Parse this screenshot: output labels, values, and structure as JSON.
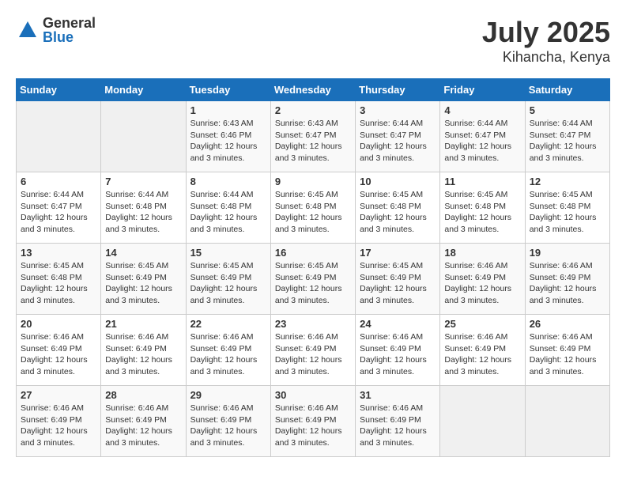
{
  "logo": {
    "general": "General",
    "blue": "Blue"
  },
  "title": {
    "month_year": "July 2025",
    "location": "Kihancha, Kenya"
  },
  "days_of_week": [
    "Sunday",
    "Monday",
    "Tuesday",
    "Wednesday",
    "Thursday",
    "Friday",
    "Saturday"
  ],
  "weeks": [
    [
      {
        "day": null
      },
      {
        "day": null
      },
      {
        "day": "1",
        "sunrise": "Sunrise: 6:43 AM",
        "sunset": "Sunset: 6:46 PM",
        "daylight": "Daylight: 12 hours and 3 minutes."
      },
      {
        "day": "2",
        "sunrise": "Sunrise: 6:43 AM",
        "sunset": "Sunset: 6:47 PM",
        "daylight": "Daylight: 12 hours and 3 minutes."
      },
      {
        "day": "3",
        "sunrise": "Sunrise: 6:44 AM",
        "sunset": "Sunset: 6:47 PM",
        "daylight": "Daylight: 12 hours and 3 minutes."
      },
      {
        "day": "4",
        "sunrise": "Sunrise: 6:44 AM",
        "sunset": "Sunset: 6:47 PM",
        "daylight": "Daylight: 12 hours and 3 minutes."
      },
      {
        "day": "5",
        "sunrise": "Sunrise: 6:44 AM",
        "sunset": "Sunset: 6:47 PM",
        "daylight": "Daylight: 12 hours and 3 minutes."
      }
    ],
    [
      {
        "day": "6",
        "sunrise": "Sunrise: 6:44 AM",
        "sunset": "Sunset: 6:47 PM",
        "daylight": "Daylight: 12 hours and 3 minutes."
      },
      {
        "day": "7",
        "sunrise": "Sunrise: 6:44 AM",
        "sunset": "Sunset: 6:48 PM",
        "daylight": "Daylight: 12 hours and 3 minutes."
      },
      {
        "day": "8",
        "sunrise": "Sunrise: 6:44 AM",
        "sunset": "Sunset: 6:48 PM",
        "daylight": "Daylight: 12 hours and 3 minutes."
      },
      {
        "day": "9",
        "sunrise": "Sunrise: 6:45 AM",
        "sunset": "Sunset: 6:48 PM",
        "daylight": "Daylight: 12 hours and 3 minutes."
      },
      {
        "day": "10",
        "sunrise": "Sunrise: 6:45 AM",
        "sunset": "Sunset: 6:48 PM",
        "daylight": "Daylight: 12 hours and 3 minutes."
      },
      {
        "day": "11",
        "sunrise": "Sunrise: 6:45 AM",
        "sunset": "Sunset: 6:48 PM",
        "daylight": "Daylight: 12 hours and 3 minutes."
      },
      {
        "day": "12",
        "sunrise": "Sunrise: 6:45 AM",
        "sunset": "Sunset: 6:48 PM",
        "daylight": "Daylight: 12 hours and 3 minutes."
      }
    ],
    [
      {
        "day": "13",
        "sunrise": "Sunrise: 6:45 AM",
        "sunset": "Sunset: 6:48 PM",
        "daylight": "Daylight: 12 hours and 3 minutes."
      },
      {
        "day": "14",
        "sunrise": "Sunrise: 6:45 AM",
        "sunset": "Sunset: 6:49 PM",
        "daylight": "Daylight: 12 hours and 3 minutes."
      },
      {
        "day": "15",
        "sunrise": "Sunrise: 6:45 AM",
        "sunset": "Sunset: 6:49 PM",
        "daylight": "Daylight: 12 hours and 3 minutes."
      },
      {
        "day": "16",
        "sunrise": "Sunrise: 6:45 AM",
        "sunset": "Sunset: 6:49 PM",
        "daylight": "Daylight: 12 hours and 3 minutes."
      },
      {
        "day": "17",
        "sunrise": "Sunrise: 6:45 AM",
        "sunset": "Sunset: 6:49 PM",
        "daylight": "Daylight: 12 hours and 3 minutes."
      },
      {
        "day": "18",
        "sunrise": "Sunrise: 6:46 AM",
        "sunset": "Sunset: 6:49 PM",
        "daylight": "Daylight: 12 hours and 3 minutes."
      },
      {
        "day": "19",
        "sunrise": "Sunrise: 6:46 AM",
        "sunset": "Sunset: 6:49 PM",
        "daylight": "Daylight: 12 hours and 3 minutes."
      }
    ],
    [
      {
        "day": "20",
        "sunrise": "Sunrise: 6:46 AM",
        "sunset": "Sunset: 6:49 PM",
        "daylight": "Daylight: 12 hours and 3 minutes."
      },
      {
        "day": "21",
        "sunrise": "Sunrise: 6:46 AM",
        "sunset": "Sunset: 6:49 PM",
        "daylight": "Daylight: 12 hours and 3 minutes."
      },
      {
        "day": "22",
        "sunrise": "Sunrise: 6:46 AM",
        "sunset": "Sunset: 6:49 PM",
        "daylight": "Daylight: 12 hours and 3 minutes."
      },
      {
        "day": "23",
        "sunrise": "Sunrise: 6:46 AM",
        "sunset": "Sunset: 6:49 PM",
        "daylight": "Daylight: 12 hours and 3 minutes."
      },
      {
        "day": "24",
        "sunrise": "Sunrise: 6:46 AM",
        "sunset": "Sunset: 6:49 PM",
        "daylight": "Daylight: 12 hours and 3 minutes."
      },
      {
        "day": "25",
        "sunrise": "Sunrise: 6:46 AM",
        "sunset": "Sunset: 6:49 PM",
        "daylight": "Daylight: 12 hours and 3 minutes."
      },
      {
        "day": "26",
        "sunrise": "Sunrise: 6:46 AM",
        "sunset": "Sunset: 6:49 PM",
        "daylight": "Daylight: 12 hours and 3 minutes."
      }
    ],
    [
      {
        "day": "27",
        "sunrise": "Sunrise: 6:46 AM",
        "sunset": "Sunset: 6:49 PM",
        "daylight": "Daylight: 12 hours and 3 minutes."
      },
      {
        "day": "28",
        "sunrise": "Sunrise: 6:46 AM",
        "sunset": "Sunset: 6:49 PM",
        "daylight": "Daylight: 12 hours and 3 minutes."
      },
      {
        "day": "29",
        "sunrise": "Sunrise: 6:46 AM",
        "sunset": "Sunset: 6:49 PM",
        "daylight": "Daylight: 12 hours and 3 minutes."
      },
      {
        "day": "30",
        "sunrise": "Sunrise: 6:46 AM",
        "sunset": "Sunset: 6:49 PM",
        "daylight": "Daylight: 12 hours and 3 minutes."
      },
      {
        "day": "31",
        "sunrise": "Sunrise: 6:46 AM",
        "sunset": "Sunset: 6:49 PM",
        "daylight": "Daylight: 12 hours and 3 minutes."
      },
      {
        "day": null
      },
      {
        "day": null
      }
    ]
  ]
}
